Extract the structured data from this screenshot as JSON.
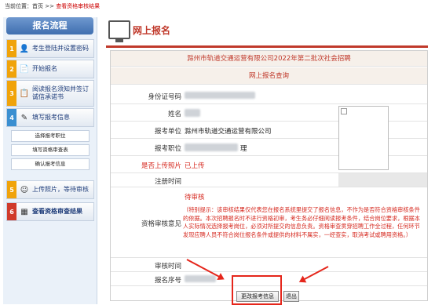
{
  "breadcrumb": {
    "prefix": "当前位置：",
    "home": "首页",
    "sep1": " >> ",
    "current": "查看资格审核结果"
  },
  "sidebar": {
    "title": "报名流程",
    "steps": [
      {
        "num": "1",
        "label": "考生登陆并设置密码",
        "color": "#f0a30a"
      },
      {
        "num": "2",
        "label": "开始报名",
        "color": "#f0a30a"
      },
      {
        "num": "3",
        "label": "阅读报名须知并签订诚信承诺书",
        "color": "#f0a30a"
      },
      {
        "num": "4",
        "label": "填写报考信息",
        "color": "#3a8fd1"
      },
      {
        "num": "5",
        "label": "上传照片，等待审核",
        "color": "#f0a30a"
      },
      {
        "num": "6",
        "label": "查看资格审查结果",
        "color": "#d03a2a"
      }
    ],
    "subitems": [
      "选择报考职位",
      "填写资格审查表",
      "确认报考信息"
    ]
  },
  "main": {
    "title": "网上报名",
    "header1": "滁州市轨道交通运营有限公司2022年第二批次社会招聘",
    "header2": "网上报名查询",
    "fields": {
      "id_label": "身份证号码",
      "name_label": "姓名",
      "unit_label": "报考单位",
      "unit_value": "滁州市轨道交通运营有限公司",
      "position_label": "报考职位",
      "position_suffix": "理",
      "photo_label": "是否上传照片",
      "photo_value": "已上传",
      "regtime_label": "注册时间",
      "review_label": "资格审核意见",
      "review_status": "待审核",
      "review_note": "（特别提示：该审核结果仅代表您在报名系统里提交了报名信息，不作为是否符合资格审核条件的依据。本次招聘报名时不进行资格初审，考生务必仔细阅读报考条件，结合岗位要求，根据本人实际情况选择报考岗位，必须对所提交的信息负责。资格审查贯穿招聘工作全过程，任何环节发现应聘人员不符合岗位报名条件或提供的材料不属实，一经查实，取消考试或聘用资格。）",
      "reviewtime_label": "审核时间",
      "seq_label": "报名序号"
    },
    "buttons": {
      "modify": "更改报考信息",
      "exit": "退出"
    }
  }
}
